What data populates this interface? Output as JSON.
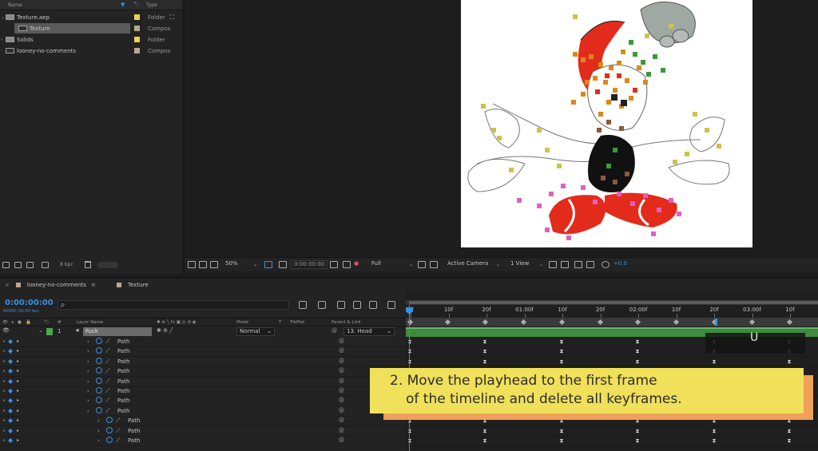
{
  "project": {
    "header": {
      "name": "Name",
      "type": "Type"
    },
    "items": [
      {
        "name": "Texture.aep",
        "type": "Folder",
        "kind": "folder",
        "label_color": "#e8d54a"
      },
      {
        "name": "Texture",
        "type": "Compos",
        "kind": "comp",
        "label_color": "#b8a892",
        "selected": true
      },
      {
        "name": "Solids",
        "type": "Folder",
        "kind": "folder",
        "label_color": "#e8d54a"
      },
      {
        "name": "looney-no-comments",
        "type": "Compos",
        "kind": "comp",
        "label_color": "#b8a892"
      }
    ],
    "bpc": "8 bpc"
  },
  "viewer": {
    "zoom": "50%",
    "timecode": "0:00:00:00",
    "resolution": "Full",
    "camera": "Active Camera",
    "view": "1 View",
    "exposure": "+0.0"
  },
  "timeline": {
    "tabs": [
      {
        "label": "looney-no-comments",
        "color": "#b8a892"
      },
      {
        "label": "Texture",
        "color": "#b8a892"
      }
    ],
    "timecode": "0:00:00:00",
    "timecode_sub": "00000 (30.00 fps)",
    "search_placeholder": "ρ·",
    "columns": {
      "hash": "#",
      "layer_name": "Layer Name",
      "mode": "Mode",
      "t": "T",
      "trkmat": "TrkMat",
      "parent": "Parent & Link"
    },
    "layer": {
      "num": "1",
      "name": "Fuck",
      "mode": "Normal",
      "parent": "13. Head"
    },
    "paths": [
      {
        "label": "Path",
        "indent": 0
      },
      {
        "label": "Path",
        "indent": 0
      },
      {
        "label": "Path",
        "indent": 0
      },
      {
        "label": "Path",
        "indent": 0
      },
      {
        "label": "Path",
        "indent": 0
      },
      {
        "label": "Path",
        "indent": 0
      },
      {
        "label": "Path",
        "indent": 0
      },
      {
        "label": "Path",
        "indent": 0
      },
      {
        "label": "Path",
        "indent": 1
      },
      {
        "label": "Path",
        "indent": 1
      },
      {
        "label": "Path",
        "indent": 1
      }
    ],
    "ruler_labels": [
      "0f",
      "10f",
      "20f",
      "01:00f",
      "10f",
      "20f",
      "02:00f",
      "10f",
      "20f",
      "03:00f",
      "10f"
    ]
  },
  "caption": {
    "line1": "2. Move the playhead to the first frame",
    "line2": "of the timeline and delete all keyframes.",
    "color": "#f0e05a",
    "shadow_color": "#f0a05a"
  },
  "cursor_glyph": "U"
}
